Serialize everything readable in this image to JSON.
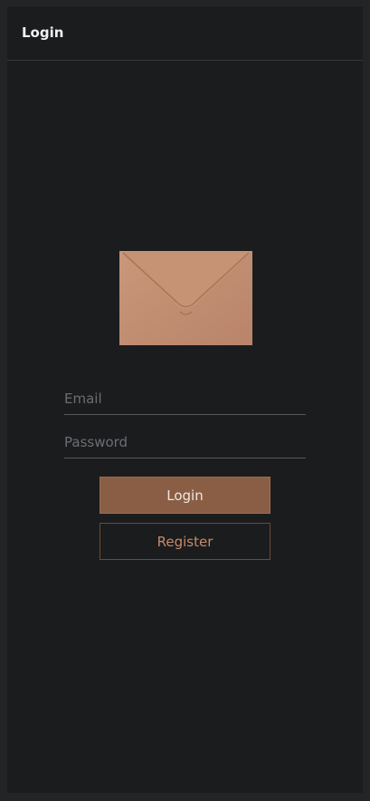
{
  "header": {
    "title": "Login"
  },
  "login_form": {
    "email_placeholder": "Email",
    "email_value": "",
    "password_placeholder": "Password",
    "password_value": "",
    "login_label": "Login",
    "register_label": "Register"
  },
  "colors": {
    "page_background": "#232425",
    "window_background": "#1b1c1e",
    "accent": "#8a5e45",
    "accent_text": "#c48b6a",
    "envelope": "#c79677"
  },
  "icons": {
    "hero": "envelope-image"
  }
}
